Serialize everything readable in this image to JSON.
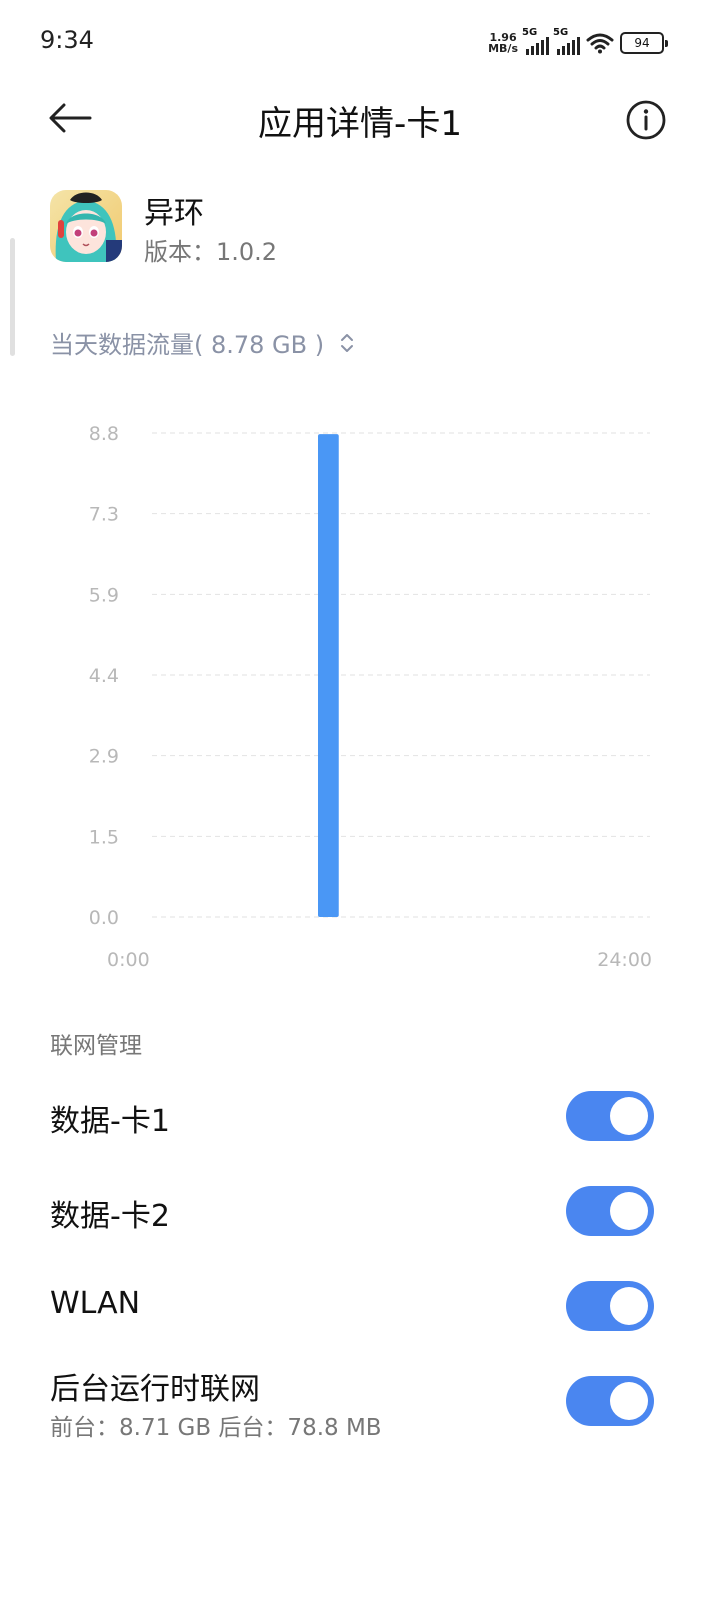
{
  "status_bar": {
    "time": "9:34",
    "net_speed_value": "1.96",
    "net_speed_unit": "MB/s",
    "sim1_type": "5G",
    "sim2_type": "5G",
    "battery": "94"
  },
  "header": {
    "title": "应用详情-卡1",
    "back_icon": "arrow-left-icon",
    "info_icon": "info-circle-icon"
  },
  "app": {
    "name": "异环",
    "version": "版本：1.0.2"
  },
  "usage": {
    "label": "当天数据流量( 8.78 GB )",
    "dropdown_icon": "chevron-up-down-icon"
  },
  "chart_data": {
    "type": "bar",
    "x_start_label": "0:00",
    "x_end_label": "24:00",
    "ytick_labels": [
      "0.0",
      "1.5",
      "2.9",
      "4.4",
      "5.9",
      "7.3",
      "8.8"
    ],
    "ylim": [
      0,
      8.8
    ],
    "xlim": [
      0,
      24
    ],
    "bars": [
      {
        "x": 8,
        "width": 1,
        "value": 8.78
      }
    ],
    "bar_color": "#4a97f5",
    "grid": true
  },
  "network": {
    "section_title": "联网管理",
    "rows": [
      {
        "label": "数据-卡1",
        "enabled": true
      },
      {
        "label": "数据-卡2",
        "enabled": true
      },
      {
        "label": "WLAN",
        "enabled": true
      },
      {
        "label": "后台运行时联网",
        "sub": "前台：8.71 GB  后台：78.8 MB",
        "enabled": true
      }
    ]
  },
  "colors": {
    "accent": "#4a86f0",
    "muted_text": "#8a92a6"
  }
}
